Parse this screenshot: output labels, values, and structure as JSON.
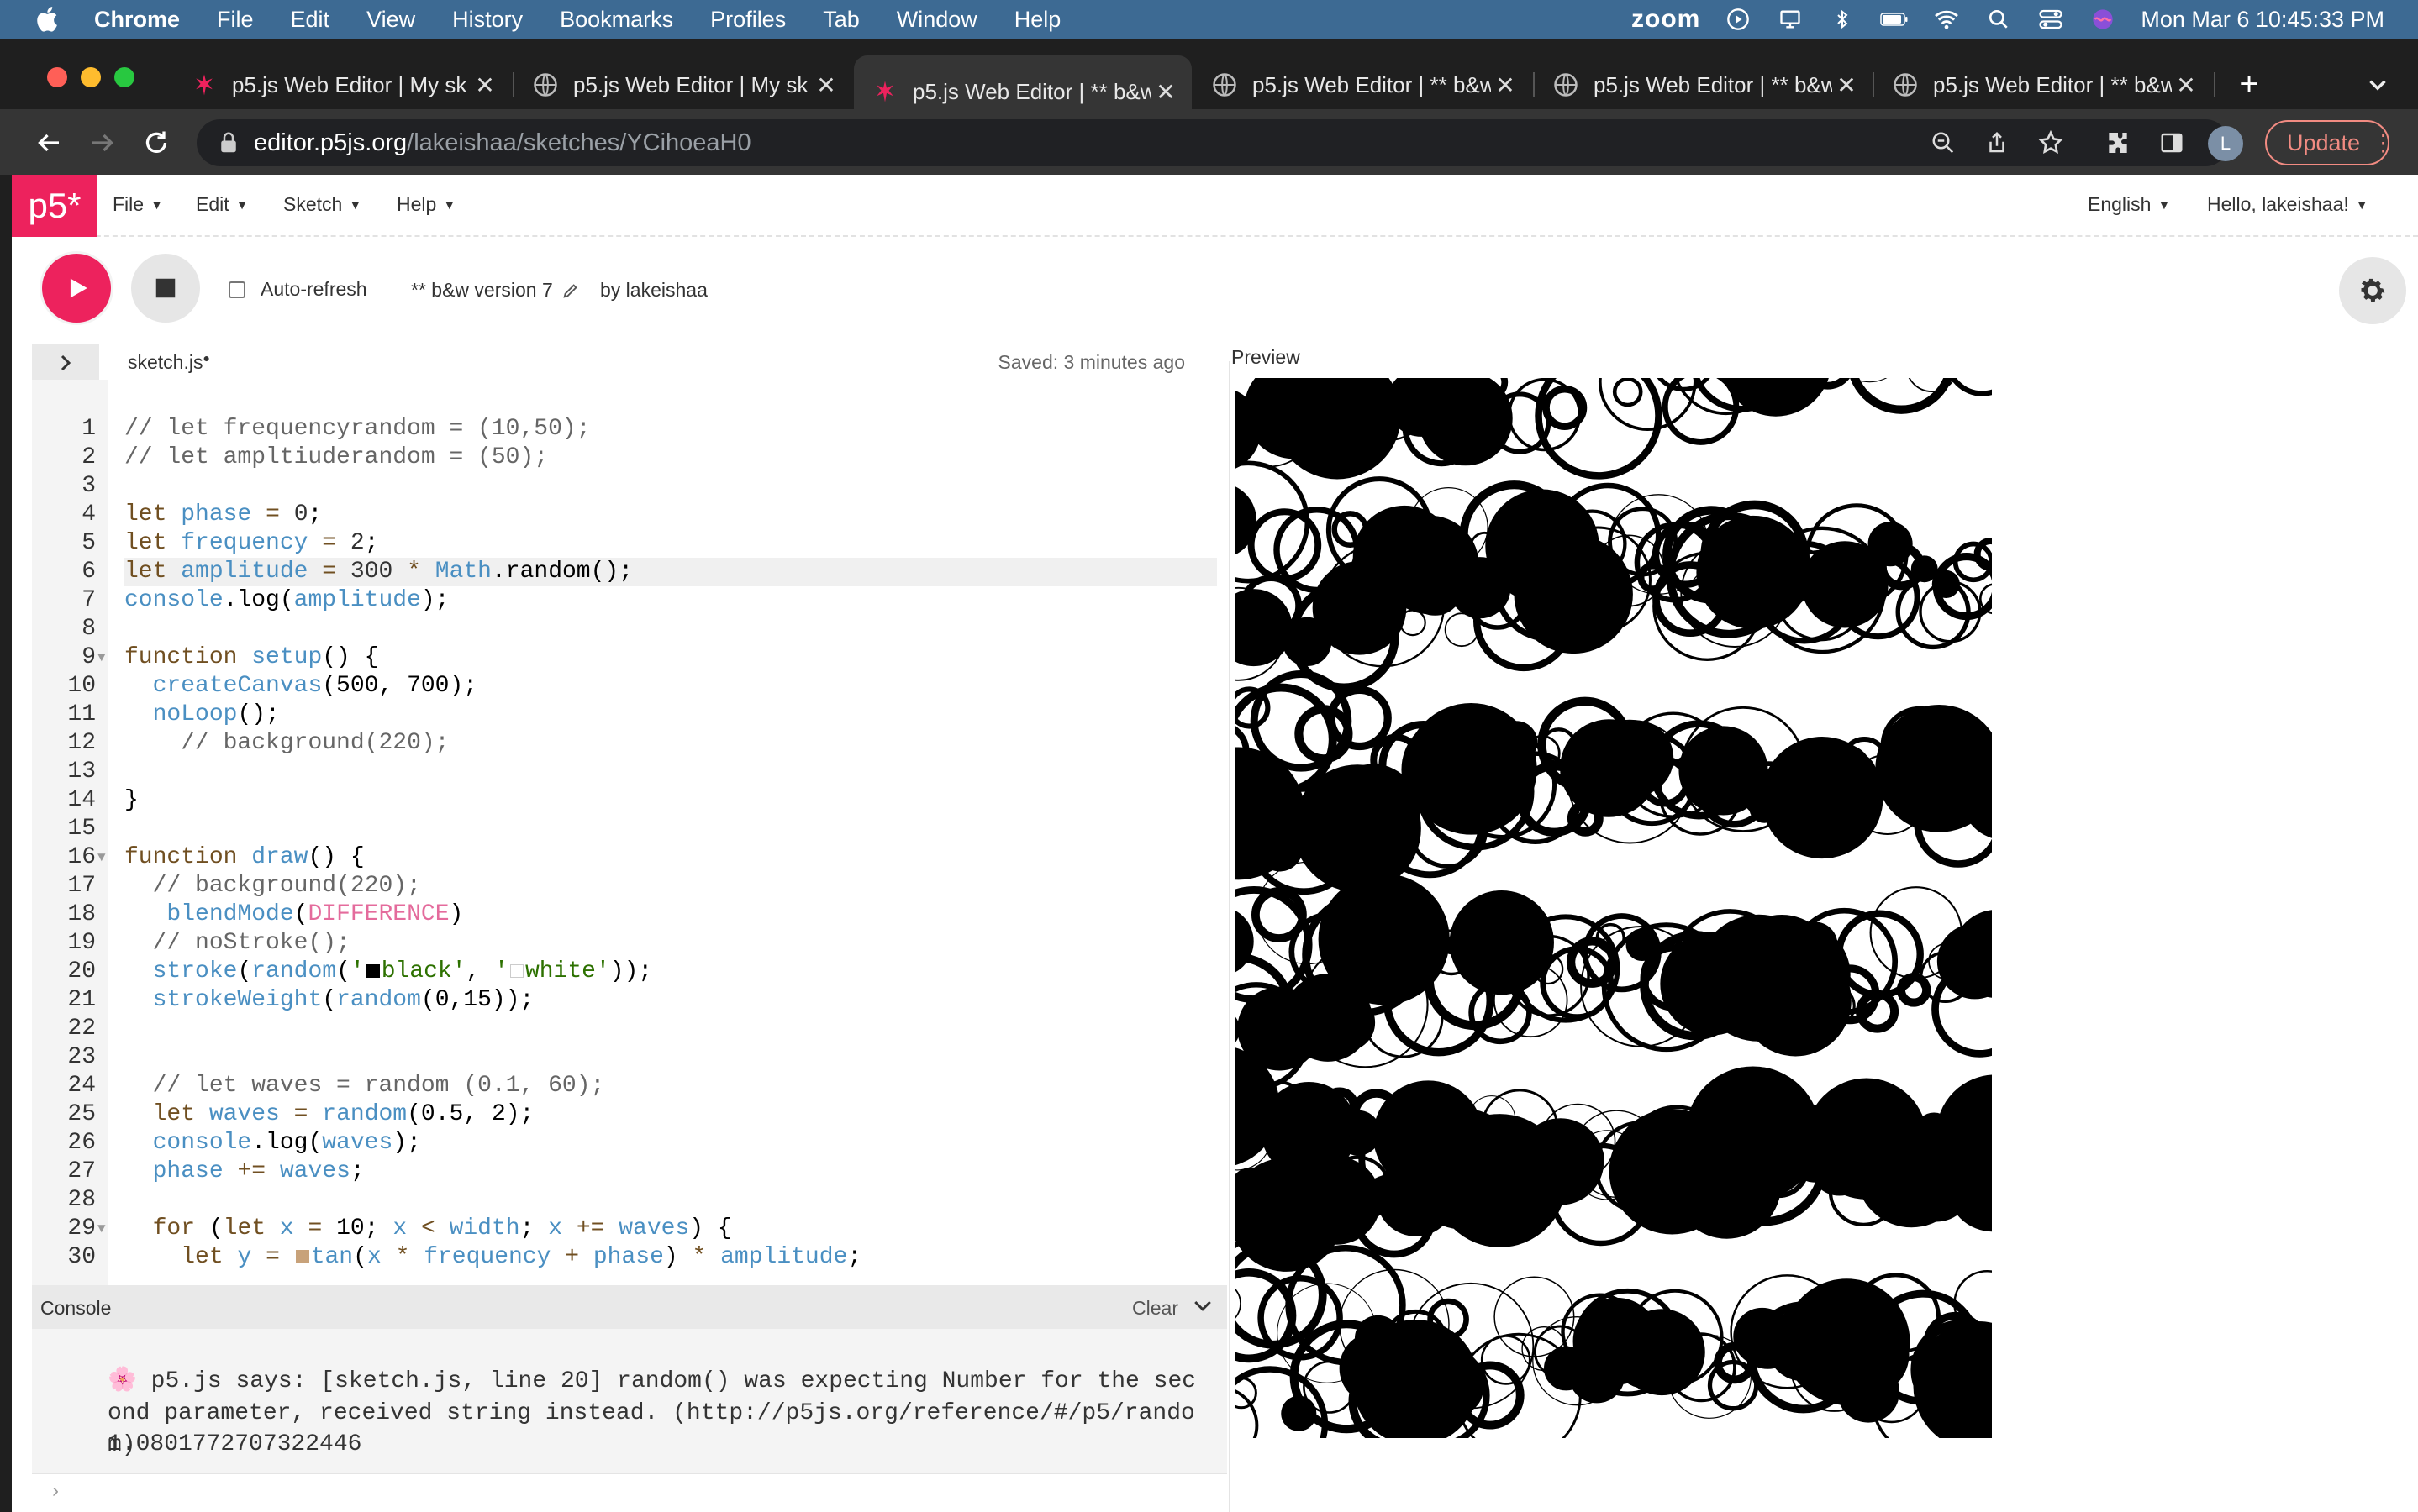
{
  "menubar": {
    "app": "Chrome",
    "items": [
      "File",
      "Edit",
      "View",
      "History",
      "Bookmarks",
      "Profiles",
      "Tab",
      "Window",
      "Help"
    ],
    "zoom": "zoom",
    "datetime": "Mon Mar 6  10:45:33 PM"
  },
  "tabs": [
    {
      "title": "p5.js Web Editor | My sk",
      "icon": "p5-asterisk-icon"
    },
    {
      "title": "p5.js Web Editor | My sk",
      "icon": "globe-icon"
    },
    {
      "title": "p5.js Web Editor | ** b&w",
      "icon": "p5-asterisk-icon"
    },
    {
      "title": "p5.js Web Editor | ** b&w",
      "icon": "globe-icon"
    },
    {
      "title": "p5.js Web Editor | ** b&w",
      "icon": "globe-icon"
    },
    {
      "title": "p5.js Web Editor | ** b&w",
      "icon": "globe-icon"
    }
  ],
  "address": {
    "host": "editor.p5js.org",
    "path": "/lakeishaa/sketches/YCihoeaH0"
  },
  "profile_initial": "L",
  "update_label": "Update",
  "p5nav": {
    "logo": "p5*",
    "file": "File",
    "edit": "Edit",
    "sketch": "Sketch",
    "help": "Help",
    "language": "English",
    "greeting": "Hello, lakeishaa!"
  },
  "p5toolbar": {
    "autorefresh": "Auto-refresh",
    "sketch_name": "** b&w version 7",
    "by": "by lakeishaa"
  },
  "editor": {
    "file_tab": "sketch.js",
    "saved": "Saved: 3 minutes ago",
    "preview_label": "Preview"
  },
  "console": {
    "title": "Console",
    "clear": "Clear",
    "message": "🌸 p5.js says: [sketch.js, line 20] random() was expecting Number for the second parameter, received string instead. (http://p5js.org/reference/#/p5/random)",
    "output": "1.0801772707322446"
  },
  "colors": {
    "accent": "#ed225d",
    "update": "#f28b82",
    "menubar": "#3d6a93"
  }
}
